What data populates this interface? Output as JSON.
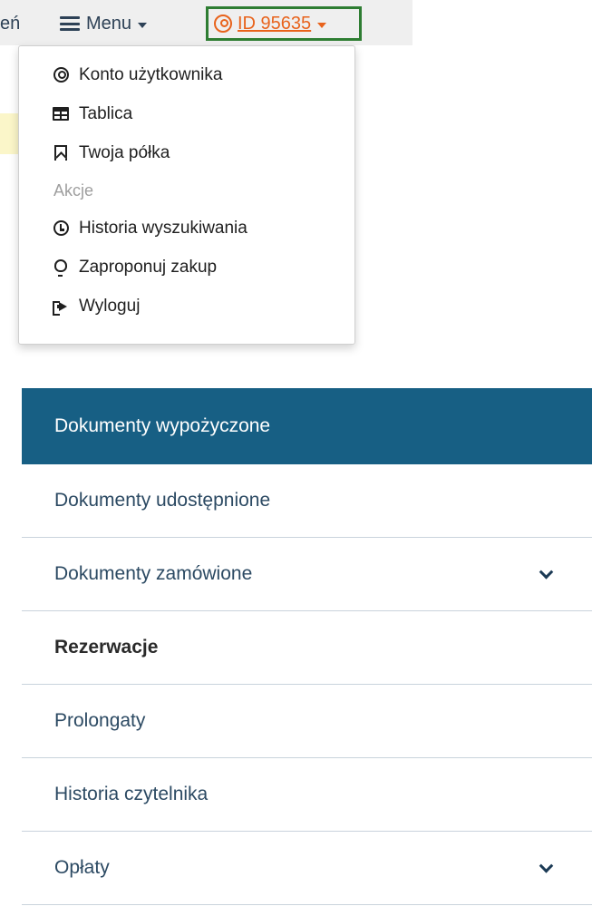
{
  "topbar": {
    "partial_label": "eń",
    "menu_label": "Menu",
    "user_id_label": "ID 95635"
  },
  "dropdown": {
    "items": [
      {
        "label": "Konto użytkownika",
        "icon": "account-circle-icon"
      },
      {
        "label": "Tablica",
        "icon": "table-icon"
      },
      {
        "label": "Twoja półka",
        "icon": "bookmark-icon"
      }
    ],
    "section_header": "Akcje",
    "actions": [
      {
        "label": "Historia wyszukiwania",
        "icon": "clock-icon"
      },
      {
        "label": "Zaproponuj zakup",
        "icon": "lightbulb-icon"
      },
      {
        "label": "Wyloguj",
        "icon": "logout-icon"
      }
    ]
  },
  "nav": {
    "items": [
      {
        "label": "Dokumenty wypożyczone"
      },
      {
        "label": "Dokumenty udostępnione"
      },
      {
        "label": "Dokumenty zamówione"
      },
      {
        "label": "Rezerwacje"
      },
      {
        "label": "Prolongaty"
      },
      {
        "label": "Historia czytelnika"
      },
      {
        "label": "Opłaty"
      }
    ]
  },
  "colors": {
    "accent": "#175f84",
    "id_highlight": "#e8631c",
    "id_border": "#2e7d32"
  }
}
